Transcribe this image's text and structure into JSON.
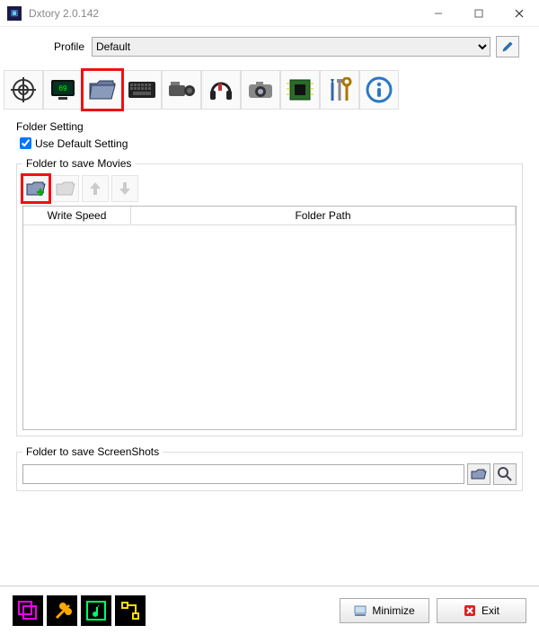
{
  "window": {
    "title": "Dxtory 2.0.142"
  },
  "profile": {
    "label": "Profile",
    "selected": "Default"
  },
  "tabs": [
    {
      "name": "target",
      "icon": "crosshair"
    },
    {
      "name": "monitor",
      "icon": "monitor"
    },
    {
      "name": "folder",
      "icon": "folder",
      "selected": true
    },
    {
      "name": "keyboard",
      "icon": "keyboard"
    },
    {
      "name": "video",
      "icon": "camcorder"
    },
    {
      "name": "audio",
      "icon": "headphones"
    },
    {
      "name": "camera",
      "icon": "camera"
    },
    {
      "name": "gpu",
      "icon": "chip"
    },
    {
      "name": "tools",
      "icon": "tools"
    },
    {
      "name": "info",
      "icon": "info"
    }
  ],
  "folder_setting": {
    "heading": "Folder Setting",
    "use_default_label": "Use Default Setting",
    "use_default_checked": true,
    "movies_legend": "Folder to save Movies",
    "toolbar": {
      "add": {
        "name": "add-folder",
        "highlighted": true
      },
      "open": {
        "name": "open-folder"
      },
      "up": {
        "name": "move-up"
      },
      "down": {
        "name": "move-down"
      }
    },
    "columns": {
      "write_speed": "Write Speed",
      "folder_path": "Folder Path"
    },
    "screenshots_legend": "Folder to save ScreenShots",
    "screenshots_path": ""
  },
  "footer": {
    "minimize": "Minimize",
    "exit": "Exit"
  }
}
